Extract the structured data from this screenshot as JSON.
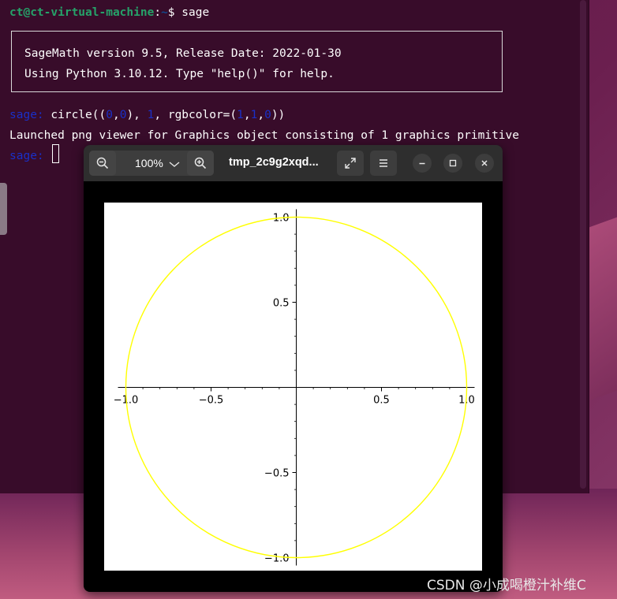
{
  "terminal": {
    "prompt_user": "ct@ct-virtual-machine",
    "prompt_sep": ":",
    "prompt_path": "~",
    "prompt_dollar": "$ ",
    "command": "sage",
    "banner_line1": "SageMath version 9.5, Release Date: 2022-01-30",
    "banner_line2": "Using Python 3.10.12. Type \"help()\" for help.",
    "sage_prompt": "sage:",
    "input_parts": {
      "p1": " circle((",
      "n1": "0",
      "c1": ",",
      "n2": "0",
      "p2": "), ",
      "n3": "1",
      "p3": ", rgbcolor=(",
      "n4": "1",
      "c2": ",",
      "n5": "1",
      "c3": ",",
      "n6": "0",
      "p4": "))"
    },
    "output_line": "Launched png viewer for Graphics object consisting of 1 graphics primitive",
    "sage_prompt2": "sage:"
  },
  "viewer": {
    "zoom_level": "100%",
    "file_title": "tmp_2c9g2xqd...",
    "icons": {
      "zoom_out": "zoom-out-icon",
      "zoom_dropdown": "chevron-down-icon",
      "zoom_in": "zoom-in-icon",
      "fullscreen": "fullscreen-icon",
      "menu": "hamburger-menu-icon",
      "minimize": "minimize-icon",
      "maximize": "maximize-icon",
      "close": "close-icon"
    }
  },
  "chart_data": {
    "type": "line",
    "title": "",
    "xlabel": "",
    "ylabel": "",
    "xlim": [
      -1.0,
      1.0
    ],
    "ylim": [
      -1.0,
      1.0
    ],
    "x_ticks": [
      {
        "value": -1.0,
        "label": "−1.0"
      },
      {
        "value": -0.5,
        "label": "−0.5"
      },
      {
        "value": 0.5,
        "label": "0.5"
      },
      {
        "value": 1.0,
        "label": "1.0"
      }
    ],
    "y_ticks": [
      {
        "value": 1.0,
        "label": "1.0"
      },
      {
        "value": 0.5,
        "label": "0.5"
      },
      {
        "value": -0.5,
        "label": "−0.5"
      },
      {
        "value": -1.0,
        "label": "−1.0"
      }
    ],
    "series": [
      {
        "shape": "circle",
        "center": [
          0,
          0
        ],
        "radius": 1,
        "color": "#ffff00"
      }
    ],
    "grid": false
  },
  "watermark": "CSDN @小成喝橙汁补维C"
}
